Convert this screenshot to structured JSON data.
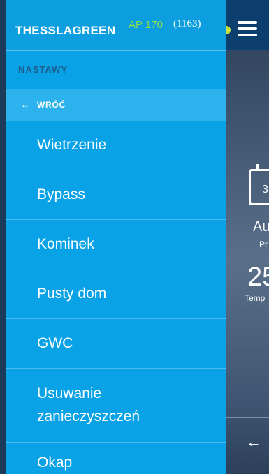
{
  "header": {
    "brand": "THESSLAGREEN",
    "model": "AP 170",
    "count": "(1163)"
  },
  "section_title": "NASTAWY",
  "back_label": "WRÓĆ",
  "menu_items": [
    "Wietrzenie",
    "Bypass",
    "Kominek",
    "Pusty dom",
    "GWC",
    "Usuwanie zanieczyszczeń",
    "Okap"
  ],
  "background": {
    "calendar_digit": "3",
    "mode_text": "Au",
    "mode_sub": "Pr",
    "temperature": "25",
    "temp_label": "Temp"
  },
  "colors": {
    "drawer": "#0aa2e6",
    "model_green": "#8fe04d",
    "indicator": "#c9e23a"
  }
}
